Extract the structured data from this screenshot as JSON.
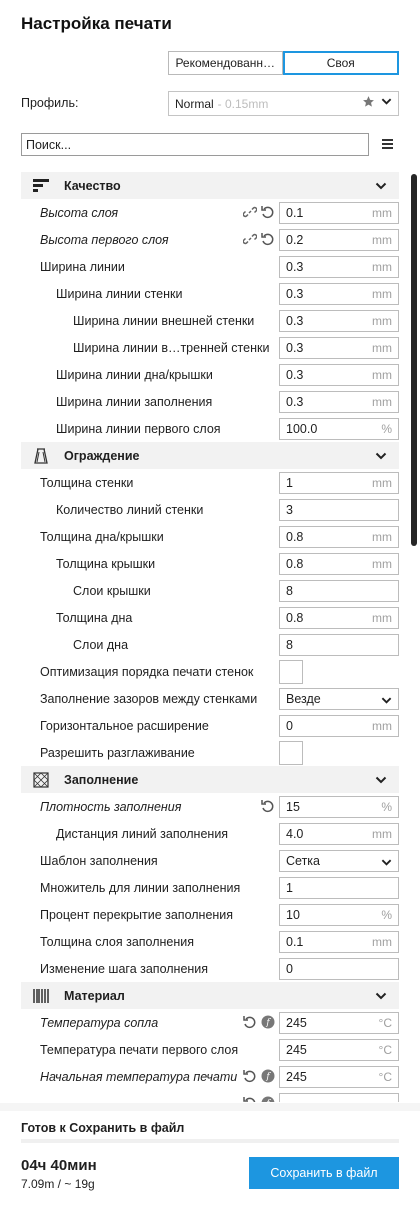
{
  "header": {
    "title": "Настройка печати"
  },
  "mode_buttons": [
    {
      "label": "Рекомендованн…",
      "active": false
    },
    {
      "label": "Своя",
      "active": true
    }
  ],
  "profile": {
    "label": "Профиль:",
    "value": "Normal",
    "sub": "- 0.15mm"
  },
  "search": {
    "placeholder": "Поиск..."
  },
  "sections": [
    {
      "type": "cat",
      "label": "Качество",
      "icon": "quality-icon"
    },
    {
      "type": "row",
      "label": "Высота слоя",
      "italic": true,
      "indent": 0,
      "value": "0.1",
      "unit": "mm",
      "actions": [
        "link-icon",
        "reset-icon"
      ]
    },
    {
      "type": "row",
      "label": "Высота первого слоя",
      "italic": true,
      "indent": 0,
      "value": "0.2",
      "unit": "mm",
      "actions": [
        "link-icon",
        "reset-icon"
      ]
    },
    {
      "type": "row",
      "label": "Ширина линии",
      "indent": 0,
      "value": "0.3",
      "unit": "mm"
    },
    {
      "type": "row",
      "label": "Ширина линии стенки",
      "indent": 1,
      "value": "0.3",
      "unit": "mm"
    },
    {
      "type": "row",
      "label": "Ширина линии внешней стенки",
      "indent": 2,
      "value": "0.3",
      "unit": "mm"
    },
    {
      "type": "row",
      "label": "Ширина линии в…тренней стенки",
      "indent": 2,
      "value": "0.3",
      "unit": "mm"
    },
    {
      "type": "row",
      "label": "Ширина линии дна/крышки",
      "indent": 1,
      "value": "0.3",
      "unit": "mm"
    },
    {
      "type": "row",
      "label": "Ширина линии заполнения",
      "indent": 1,
      "value": "0.3",
      "unit": "mm"
    },
    {
      "type": "row",
      "label": "Ширина линии первого слоя",
      "indent": 1,
      "value": "100.0",
      "unit": "%"
    },
    {
      "type": "cat",
      "label": "Ограждение",
      "icon": "shell-icon"
    },
    {
      "type": "row",
      "label": "Толщина стенки",
      "indent": 0,
      "value": "1",
      "unit": "mm"
    },
    {
      "type": "row",
      "label": "Количество линий стенки",
      "indent": 1,
      "value": "3",
      "unit": ""
    },
    {
      "type": "row",
      "label": "Толщина дна/крышки",
      "indent": 0,
      "value": "0.8",
      "unit": "mm"
    },
    {
      "type": "row",
      "label": "Толщина крышки",
      "indent": 1,
      "value": "0.8",
      "unit": "mm"
    },
    {
      "type": "row",
      "label": "Слои крышки",
      "indent": 2,
      "value": "8",
      "unit": ""
    },
    {
      "type": "row",
      "label": "Толщина дна",
      "indent": 1,
      "value": "0.8",
      "unit": "mm"
    },
    {
      "type": "row",
      "label": "Слои дна",
      "indent": 2,
      "value": "8",
      "unit": ""
    },
    {
      "type": "row",
      "label": "Оптимизация порядка печати стенок",
      "indent": 0,
      "control": "checkbox"
    },
    {
      "type": "row",
      "label": "Заполнение зазоров между стенками",
      "indent": 0,
      "control": "select",
      "value": "Везде"
    },
    {
      "type": "row",
      "label": "Горизонтальное расширение",
      "indent": 0,
      "value": "0",
      "unit": "mm"
    },
    {
      "type": "row",
      "label": "Разрешить разглаживание",
      "indent": 0,
      "control": "checkbox"
    },
    {
      "type": "cat",
      "label": "Заполнение",
      "icon": "infill-icon"
    },
    {
      "type": "row",
      "label": "Плотность заполнения",
      "italic": true,
      "indent": 0,
      "value": "15",
      "unit": "%",
      "actions": [
        "reset-icon"
      ]
    },
    {
      "type": "row",
      "label": "Дистанция линий заполнения",
      "indent": 1,
      "value": "4.0",
      "unit": "mm"
    },
    {
      "type": "row",
      "label": "Шаблон заполнения",
      "indent": 0,
      "control": "select",
      "value": "Сетка"
    },
    {
      "type": "row",
      "label": "Множитель для линии заполнения",
      "indent": 0,
      "value": "1",
      "unit": ""
    },
    {
      "type": "row",
      "label": "Процент перекрытие заполнения",
      "indent": 0,
      "value": "10",
      "unit": "%"
    },
    {
      "type": "row",
      "label": "Толщина слоя заполнения",
      "indent": 0,
      "value": "0.1",
      "unit": "mm"
    },
    {
      "type": "row",
      "label": "Изменение шага заполнения",
      "indent": 0,
      "value": "0",
      "unit": ""
    },
    {
      "type": "cat",
      "label": "Материал",
      "icon": "material-icon"
    },
    {
      "type": "row",
      "label": "Температура сопла",
      "italic": true,
      "indent": 0,
      "value": "245",
      "unit": "°C",
      "actions": [
        "reset-icon",
        "function-icon"
      ]
    },
    {
      "type": "row",
      "label": "Температура печати первого слоя",
      "indent": 0,
      "value": "245",
      "unit": "°C"
    },
    {
      "type": "row",
      "label": "Начальная температура печати",
      "italic": true,
      "indent": 0,
      "value": "245",
      "unit": "°C",
      "actions": [
        "reset-icon",
        "function-icon"
      ]
    },
    {
      "type": "row",
      "label": "",
      "indent": 0,
      "value": "",
      "unit": "",
      "actions": [
        "reset-icon",
        "function-icon"
      ]
    }
  ],
  "footer": {
    "ready_text": "Готов к Сохранить в файл",
    "time": "04ч 40мин",
    "estimate": "7.09m / ~ 19g",
    "save_label": "Сохранить в файл"
  },
  "colors": {
    "accent": "#1d96e0",
    "category_bg": "#f2f2f2"
  }
}
